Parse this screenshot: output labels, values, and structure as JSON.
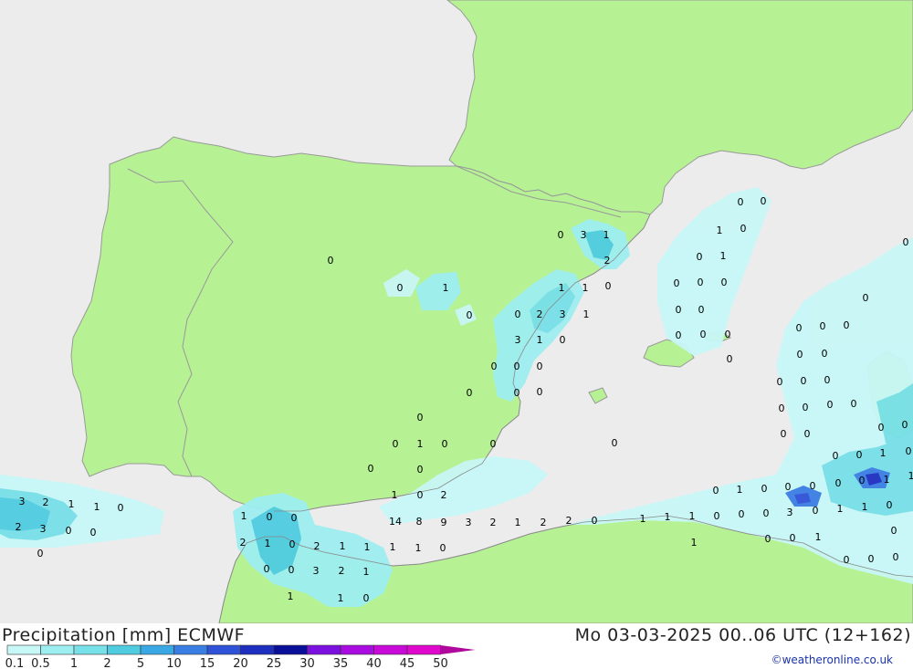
{
  "title": "Precipitation [mm] ECMWF",
  "datetime": "Mo 03-03-2025 00..06 UTC (12+162)",
  "credit": "©weatheronline.co.uk",
  "colors": {
    "sea": "#ececec",
    "land": "#b6f294",
    "coast": "#999999"
  },
  "legend": {
    "levels": [
      "0.1",
      "0.5",
      "1",
      "2",
      "5",
      "10",
      "15",
      "20",
      "25",
      "30",
      "35",
      "40",
      "45",
      "50"
    ],
    "colors": [
      "#c8f7f7",
      "#9deef0",
      "#78e0e8",
      "#4fcce0",
      "#3aa8e4",
      "#3a7ee4",
      "#2f53d8",
      "#1e2fc0",
      "#0a0f98",
      "#7c10e0",
      "#a80ce0",
      "#c80ad8",
      "#e008cc",
      "#b0089c"
    ]
  },
  "point_values": [
    {
      "v": "0"
    },
    {
      "v": "0"
    },
    {
      "v": "1"
    },
    {
      "v": "0"
    },
    {
      "v": "0"
    },
    {
      "v": "1"
    },
    {
      "v": "0"
    },
    {
      "v": "3"
    },
    {
      "v": "1"
    },
    {
      "v": "2"
    },
    {
      "v": "0"
    },
    {
      "v": "0"
    },
    {
      "v": "0"
    },
    {
      "v": "1"
    },
    {
      "v": "0"
    },
    {
      "v": "1"
    },
    {
      "v": "1"
    },
    {
      "v": "0"
    },
    {
      "v": "0"
    },
    {
      "v": "0"
    },
    {
      "v": "0"
    },
    {
      "v": "2"
    },
    {
      "v": "3"
    },
    {
      "v": "1"
    },
    {
      "v": "0"
    },
    {
      "v": "0"
    },
    {
      "v": "0"
    },
    {
      "v": "1"
    },
    {
      "v": "0"
    },
    {
      "v": "3"
    },
    {
      "v": "0"
    },
    {
      "v": "0"
    },
    {
      "v": "0"
    },
    {
      "v": "0"
    },
    {
      "v": "0"
    },
    {
      "v": "0"
    },
    {
      "v": "0"
    },
    {
      "v": "0"
    },
    {
      "v": "0"
    },
    {
      "v": "0"
    },
    {
      "v": "0"
    },
    {
      "v": "0"
    },
    {
      "v": "0"
    },
    {
      "v": "0"
    },
    {
      "v": "0"
    },
    {
      "v": "0"
    },
    {
      "v": "0"
    },
    {
      "v": "0"
    },
    {
      "v": "0"
    },
    {
      "v": "0"
    },
    {
      "v": "0"
    },
    {
      "v": "0"
    },
    {
      "v": "0"
    },
    {
      "v": "0"
    },
    {
      "v": "0"
    },
    {
      "v": "0"
    },
    {
      "v": "0"
    },
    {
      "v": "0"
    },
    {
      "v": "0"
    },
    {
      "v": "1"
    },
    {
      "v": "0"
    },
    {
      "v": "0"
    },
    {
      "v": "0"
    },
    {
      "v": "0"
    },
    {
      "v": "0"
    },
    {
      "v": "0"
    },
    {
      "v": "0"
    },
    {
      "v": "1"
    },
    {
      "v": "0"
    },
    {
      "v": "0"
    },
    {
      "v": "1"
    },
    {
      "v": "0"
    },
    {
      "v": "0"
    },
    {
      "v": "0"
    },
    {
      "v": "0"
    },
    {
      "v": "0"
    },
    {
      "v": "1"
    },
    {
      "v": "1"
    },
    {
      "v": "3"
    },
    {
      "v": "0"
    },
    {
      "v": "1"
    },
    {
      "v": "1"
    },
    {
      "v": "0"
    },
    {
      "v": "1"
    },
    {
      "v": "0"
    },
    {
      "v": "2"
    },
    {
      "v": "14"
    },
    {
      "v": "8"
    },
    {
      "v": "9"
    },
    {
      "v": "3"
    },
    {
      "v": "2"
    },
    {
      "v": "1"
    },
    {
      "v": "2"
    },
    {
      "v": "2"
    },
    {
      "v": "0"
    },
    {
      "v": "1"
    },
    {
      "v": "1"
    },
    {
      "v": "1"
    },
    {
      "v": "0"
    },
    {
      "v": "0"
    },
    {
      "v": "0"
    },
    {
      "v": "0"
    },
    {
      "v": "3"
    },
    {
      "v": "2"
    },
    {
      "v": "1"
    },
    {
      "v": "1"
    },
    {
      "v": "0"
    },
    {
      "v": "2"
    },
    {
      "v": "3"
    },
    {
      "v": "0"
    },
    {
      "v": "0"
    },
    {
      "v": "0"
    },
    {
      "v": "1"
    },
    {
      "v": "0"
    },
    {
      "v": "0"
    },
    {
      "v": "2"
    },
    {
      "v": "1"
    },
    {
      "v": "0"
    },
    {
      "v": "2"
    },
    {
      "v": "1"
    },
    {
      "v": "1"
    },
    {
      "v": "1"
    },
    {
      "v": "1"
    },
    {
      "v": "0"
    },
    {
      "v": "0"
    },
    {
      "v": "0"
    },
    {
      "v": "3"
    },
    {
      "v": "2"
    },
    {
      "v": "1"
    },
    {
      "v": "1"
    },
    {
      "v": "1"
    },
    {
      "v": "0"
    },
    {
      "v": "1"
    },
    {
      "v": "0"
    },
    {
      "v": "0"
    },
    {
      "v": "1"
    },
    {
      "v": "0"
    },
    {
      "v": "0"
    },
    {
      "v": "0"
    },
    {
      "v": "0"
    },
    {
      "v": "0"
    },
    {
      "v": "0"
    },
    {
      "v": "0"
    },
    {
      "v": "0"
    },
    {
      "v": "0"
    },
    {
      "v": "0"
    },
    {
      "v": "0"
    },
    {
      "v": "0"
    },
    {
      "v": "0"
    },
    {
      "v": "0"
    },
    {
      "v": "0"
    },
    {
      "v": "0"
    },
    {
      "v": "0"
    },
    {
      "v": "0"
    },
    {
      "v": "0"
    },
    {
      "v": "0"
    }
  ]
}
